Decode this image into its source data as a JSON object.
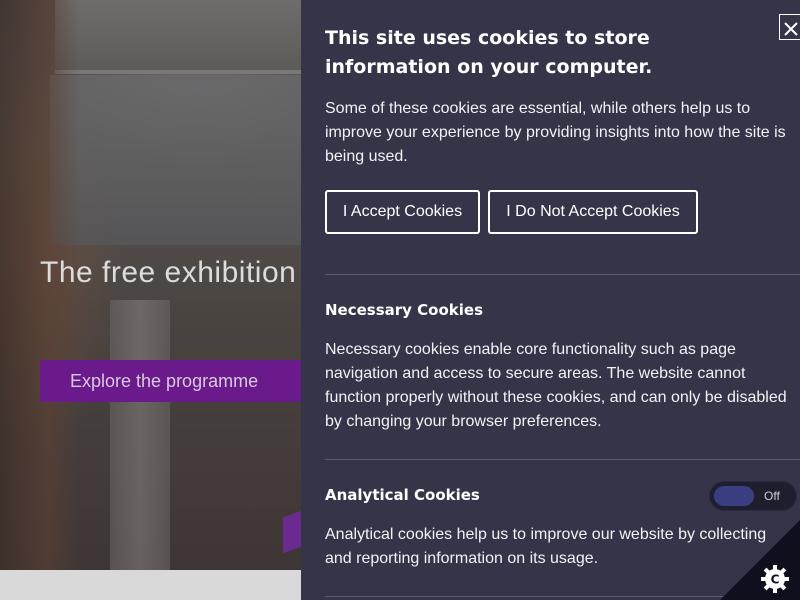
{
  "hero": {
    "heading": "The free exhibition programme is now",
    "cta_label": "Explore the programme"
  },
  "cookie_panel": {
    "close_icon": "close-icon",
    "title": "This site uses cookies to store information on your computer.",
    "intro": "Some of these cookies are essential, while others help us to improve your experience by providing insights into how the site is being used.",
    "accept_label": "I Accept Cookies",
    "decline_label": "I Do Not Accept Cookies",
    "necessary": {
      "title": "Necessary Cookies",
      "text": "Necessary cookies enable core functionality such as page navigation and access to secure areas. The website cannot function properly without these cookies, and can only be disabled by changing your browser preferences."
    },
    "analytical": {
      "title": "Analytical Cookies",
      "toggle_label": "Off",
      "toggle_on": false,
      "text": "Analytical cookies help us to improve our website by collecting and reporting information on its usage."
    },
    "settings_icon": "cookie-settings-icon",
    "colors": {
      "panel_bg": "#363448",
      "hero_button": "#6a1a8a",
      "toggle_knob": "#3c3d80"
    }
  }
}
